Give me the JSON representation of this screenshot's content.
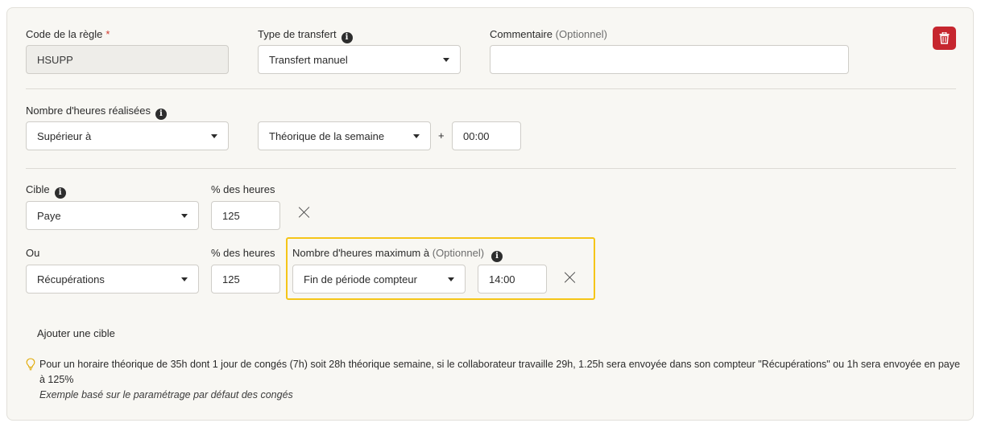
{
  "rule_code": {
    "label": "Code de la règle",
    "required_mark": "*",
    "value": "HSUPP"
  },
  "transfer_type": {
    "label": "Type de transfert",
    "value": "Transfert manuel"
  },
  "comment": {
    "label": "Commentaire",
    "optional": "(Optionnel)",
    "value": ""
  },
  "hours_done": {
    "label": "Nombre d'heures réalisées",
    "comparator": "Supérieur à",
    "reference": "Théorique de la semaine",
    "plus": "+",
    "offset": "00:00"
  },
  "targets": [
    {
      "label": "Cible",
      "value": "Paye",
      "percent_label": "% des heures",
      "percent": "125"
    },
    {
      "label": "Ou",
      "value": "Récupérations",
      "percent_label": "% des heures",
      "percent": "125",
      "max_label": "Nombre d'heures maximum à",
      "max_optional": "(Optionnel)",
      "max_period": "Fin de période compteur",
      "max_value": "14:00"
    }
  ],
  "add_target": "Ajouter une cible",
  "note": {
    "text": "Pour un horaire théorique de 35h dont 1 jour de congés (7h) soit 28h théorique semaine, si le collaborateur travaille 29h, 1.25h sera envoyée dans son compteur \"Récupérations\" ou 1h sera envoyée en paye à 125%",
    "example": "Exemple basé sur le paramétrage par défaut des congés"
  },
  "colors": {
    "highlight": "#f5c518",
    "danger": "#c6262e",
    "bulb": "#e0a800"
  }
}
